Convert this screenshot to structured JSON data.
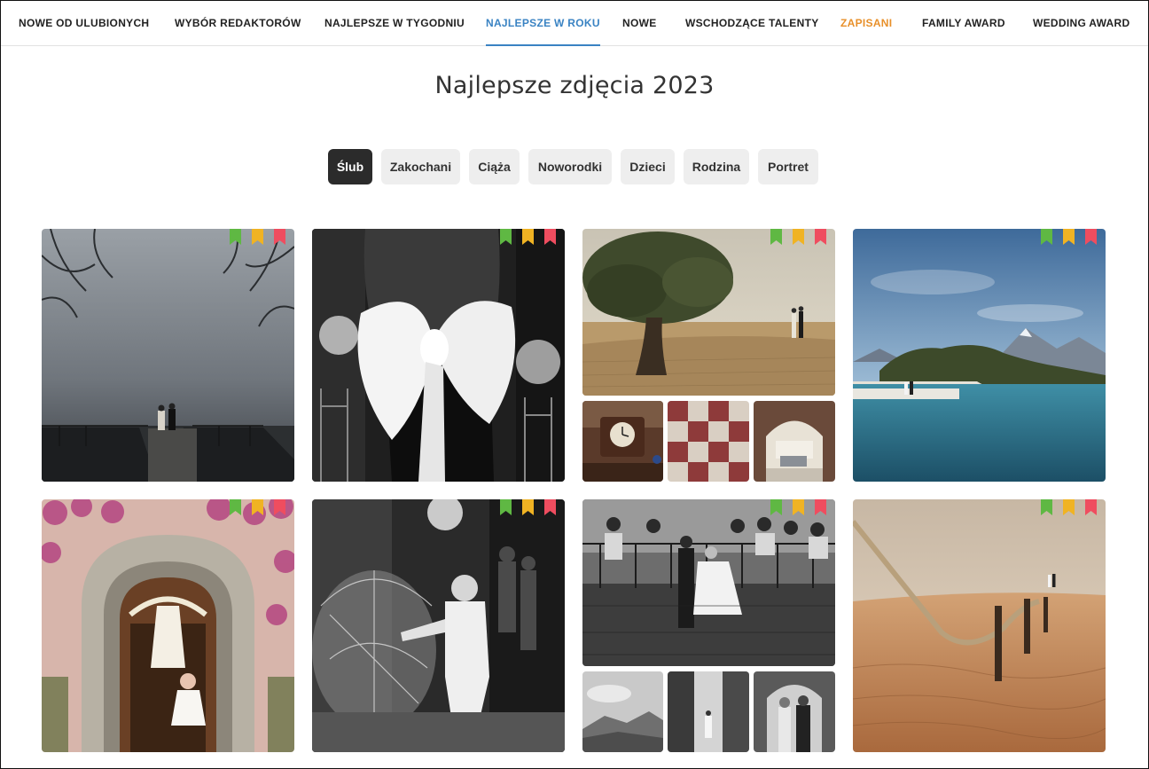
{
  "nav": {
    "items": [
      {
        "label": "NOWE OD ULUBIONYCH",
        "state": "normal"
      },
      {
        "label": "WYBÓR REDAKTORÓW",
        "state": "normal"
      },
      {
        "label": "NAJLEPSZE W TYGODNIU",
        "state": "normal"
      },
      {
        "label": "NAJLEPSZE W ROKU",
        "state": "active"
      },
      {
        "label": "NOWE",
        "state": "normal"
      },
      {
        "label": "WSCHODZĄCE TALENTY",
        "state": "normal"
      },
      {
        "label": "ZAPISANI",
        "state": "highlight"
      },
      {
        "label": "FAMILY AWARD",
        "state": "normal"
      },
      {
        "label": "WEDDING AWARD",
        "state": "normal"
      }
    ]
  },
  "page": {
    "title": "Najlepsze zdjęcia 2023"
  },
  "categories": {
    "selected": "Ślub",
    "items": [
      "Ślub",
      "Zakochani",
      "Ciąża",
      "Noworodki",
      "Dzieci",
      "Rodzina",
      "Portret"
    ]
  },
  "colors": {
    "accent": "#3a83c3",
    "saved": "#e8902a",
    "pill_active": "#2b2b2b",
    "pill_bg": "#eeeeee",
    "badge_green": "#5fb843",
    "badge_yellow": "#f0b323",
    "badge_red": "#ef4d5f"
  },
  "gallery": {
    "photos": [
      {
        "subject": "couple on pier in fog",
        "scene": "fog-pier",
        "badges": [
          "green",
          "yellow",
          "red"
        ]
      },
      {
        "subject": "bride with white bow on back",
        "scene": "bow-bw",
        "badges": [
          "green",
          "yellow",
          "red"
        ]
      },
      {
        "subject": "couple under tree in field",
        "scene": "tree-field",
        "badges": [
          "green",
          "yellow",
          "red"
        ]
      },
      {
        "subject": "clock detail",
        "scene": "clock"
      },
      {
        "subject": "checkered floor",
        "scene": "checker"
      },
      {
        "subject": "archway courtyard",
        "scene": "arch"
      },
      {
        "subject": "couple by mountain lake",
        "scene": "lake",
        "badges": [
          "green",
          "yellow",
          "red"
        ]
      },
      {
        "subject": "wedding dress hanging in ornate doorway",
        "scene": "doorway",
        "badges": [
          "green",
          "yellow",
          "red"
        ]
      },
      {
        "subject": "bride with umbrella in rain",
        "scene": "umbrella-bw",
        "badges": [
          "green",
          "yellow",
          "red"
        ]
      },
      {
        "subject": "bride on street with crowd",
        "scene": "crowd-bw",
        "badges": [
          "green",
          "yellow",
          "red"
        ]
      },
      {
        "subject": "mountain landscape",
        "scene": "hills-bw"
      },
      {
        "subject": "narrow street",
        "scene": "street-bw"
      },
      {
        "subject": "people in doorway",
        "scene": "people-bw"
      },
      {
        "subject": "couple on sand dune with rope fence",
        "scene": "dune",
        "badges": [
          "green",
          "yellow",
          "red"
        ]
      }
    ]
  }
}
